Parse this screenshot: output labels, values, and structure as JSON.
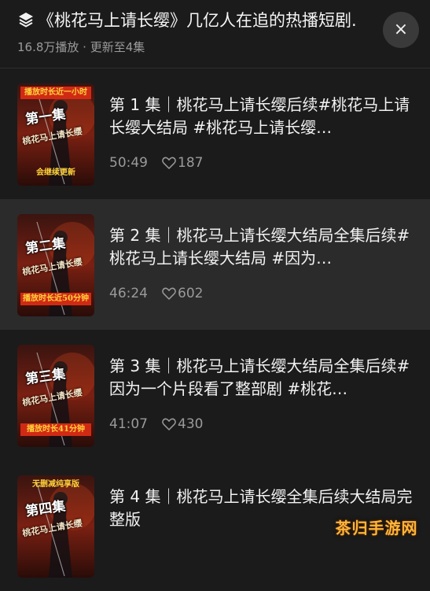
{
  "header": {
    "title": "《桃花马上请长缨》几亿人在追的热播短剧.",
    "subtitle": "16.8万播放 · 更新至4集",
    "close_label": "×"
  },
  "episodes": [
    {
      "title": "第 1 集｜桃花马上请长缨后续#桃花马上请长缨大结局 #桃花马上请长缨…",
      "duration": "50:49",
      "likes": "187",
      "poster_text": [
        "播放时长近一小时",
        "第一集",
        "桃花马上请长缨",
        "会继续更新"
      ],
      "active": false
    },
    {
      "title": "第 2 集｜桃花马上请长缨大结局全集后续#桃花马上请长缨大结局 #因为…",
      "duration": "46:24",
      "likes": "602",
      "poster_text": [
        "第二集",
        "桃花马上请长缨",
        "播放时长近50分钟"
      ],
      "active": true
    },
    {
      "title": "第 3 集｜桃花马上请长缨大结局全集后续#因为一个片段看了整部剧 #桃花…",
      "duration": "41:07",
      "likes": "430",
      "poster_text": [
        "第三集",
        "桃花马上请长缨",
        "播放时长41分钟"
      ],
      "active": false
    },
    {
      "title": "第 4 集｜桃花马上请长缨全集后续大结局完整版",
      "duration": "",
      "likes": "",
      "poster_text": [
        "无删减纯享版",
        "第四集",
        "桃花马上请长缨"
      ],
      "active": false
    }
  ],
  "watermark": "茶归手游网",
  "colors": {
    "background": "#1b1b1b",
    "active_row": "#2b2b2b",
    "muted_text": "#9a9a9a",
    "poster_red": "#d12a14",
    "poster_yellow": "#ffd23a"
  },
  "icons": {
    "header": "layers-icon",
    "close": "close-icon",
    "likes": "heart-icon"
  }
}
